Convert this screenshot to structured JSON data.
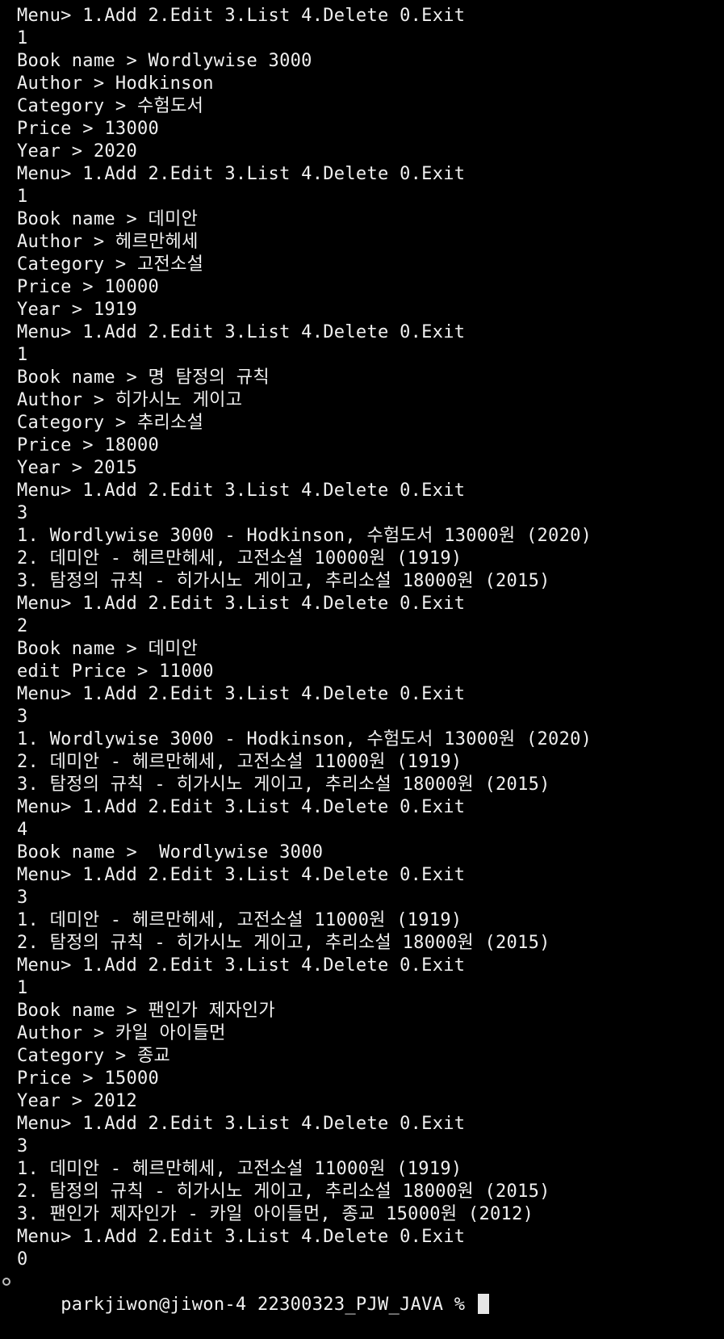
{
  "terminal": {
    "lines": [
      "Menu> 1.Add 2.Edit 3.List 4.Delete 0.Exit",
      "1",
      "Book name > Wordlywise 3000",
      "Author > Hodkinson",
      "Category > 수험도서",
      "Price > 13000",
      "Year > 2020",
      "Menu> 1.Add 2.Edit 3.List 4.Delete 0.Exit",
      "1",
      "Book name > 데미안",
      "Author > 헤르만헤세",
      "Category > 고전소설",
      "Price > 10000",
      "Year > 1919",
      "Menu> 1.Add 2.Edit 3.List 4.Delete 0.Exit",
      "1",
      "Book name > 명 탐정의 규칙",
      "Author > 히가시노 게이고",
      "Category > 추리소설",
      "Price > 18000",
      "Year > 2015",
      "Menu> 1.Add 2.Edit 3.List 4.Delete 0.Exit",
      "3",
      "1. Wordlywise 3000 - Hodkinson, 수험도서 13000원 (2020)",
      "2. 데미안 - 헤르만헤세, 고전소설 10000원 (1919)",
      "3. 탐정의 규칙 - 히가시노 게이고, 추리소설 18000원 (2015)",
      "Menu> 1.Add 2.Edit 3.List 4.Delete 0.Exit",
      "2",
      "Book name > 데미안",
      "edit Price > 11000",
      "Menu> 1.Add 2.Edit 3.List 4.Delete 0.Exit",
      "3",
      "1. Wordlywise 3000 - Hodkinson, 수험도서 13000원 (2020)",
      "2. 데미안 - 헤르만헤세, 고전소설 11000원 (1919)",
      "3. 탐정의 규칙 - 히가시노 게이고, 추리소설 18000원 (2015)",
      "Menu> 1.Add 2.Edit 3.List 4.Delete 0.Exit",
      "4",
      "Book name >  Wordlywise 3000",
      "Menu> 1.Add 2.Edit 3.List 4.Delete 0.Exit",
      "3",
      "1. 데미안 - 헤르만헤세, 고전소설 11000원 (1919)",
      "2. 탐정의 규칙 - 히가시노 게이고, 추리소설 18000원 (2015)",
      "Menu> 1.Add 2.Edit 3.List 4.Delete 0.Exit",
      "1",
      "Book name > 팬인가 제자인가",
      "Author > 카일 아이들먼",
      "Category > 종교",
      "Price > 15000",
      "Year > 2012",
      "Menu> 1.Add 2.Edit 3.List 4.Delete 0.Exit",
      "3",
      "1. 데미안 - 헤르만헤세, 고전소설 11000원 (1919)",
      "2. 탐정의 규칙 - 히가시노 게이고, 추리소설 18000원 (2015)",
      "3. 팬인가 제자인가 - 카일 아이들먼, 종교 15000원 (2012)",
      "Menu> 1.Add 2.Edit 3.List 4.Delete 0.Exit",
      "0"
    ],
    "prompt": "parkjiwon@jiwon-4 22300323_PJW_JAVA % "
  },
  "colors": {
    "background": "#000000",
    "text": "#f0f0f0",
    "cursor": "#e6e6e6"
  }
}
